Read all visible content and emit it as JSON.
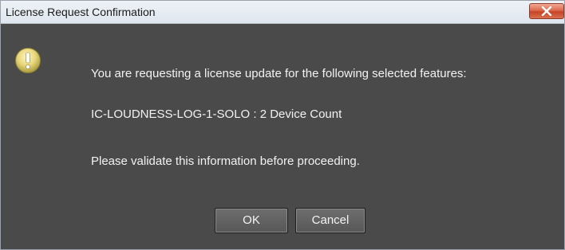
{
  "window": {
    "title": "License Request Confirmation"
  },
  "icon": {
    "name": "warning-icon",
    "color": "#e2d06a"
  },
  "message": {
    "line1": "You are requesting a license update for the following selected features:",
    "line2": "IC-LOUDNESS-LOG-1-SOLO  :  2 Device Count",
    "line3": "Please validate this information before proceeding."
  },
  "buttons": {
    "ok_label": "OK",
    "cancel_label": "Cancel"
  },
  "colors": {
    "dialog_background": "#4a4a4a",
    "close_button": "#d9593a"
  }
}
